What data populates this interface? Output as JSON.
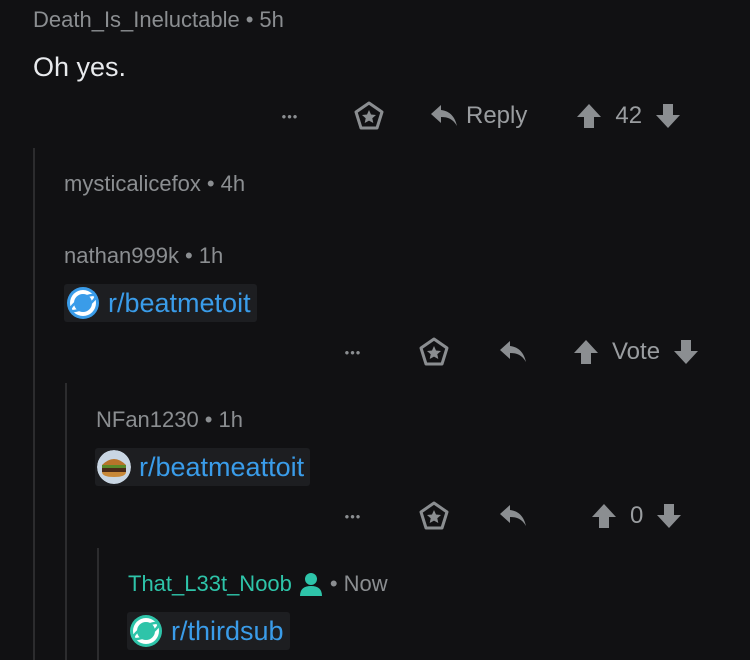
{
  "comments": [
    {
      "author": "Death_Is_Ineluctable",
      "time": "5h",
      "body": "Oh yes.",
      "reply_label": "Reply",
      "score": "42"
    },
    {
      "author": "mysticalicefox",
      "time": "4h"
    },
    {
      "author": "nathan999k",
      "time": "1h",
      "subreddit": "r/beatmetoit",
      "score": "Vote"
    },
    {
      "author": "NFan1230",
      "time": "1h",
      "subreddit": "r/beatmeattoit",
      "score": "0"
    },
    {
      "author": "That_L33t_Noob",
      "time": "Now",
      "subreddit": "r/thirdsub"
    }
  ],
  "separator": "•",
  "more_label": "•••",
  "colors": {
    "background": "#111113",
    "meta_text": "#8b8e91",
    "link": "#3a9ce9",
    "op_author": "#2ec4a9"
  }
}
